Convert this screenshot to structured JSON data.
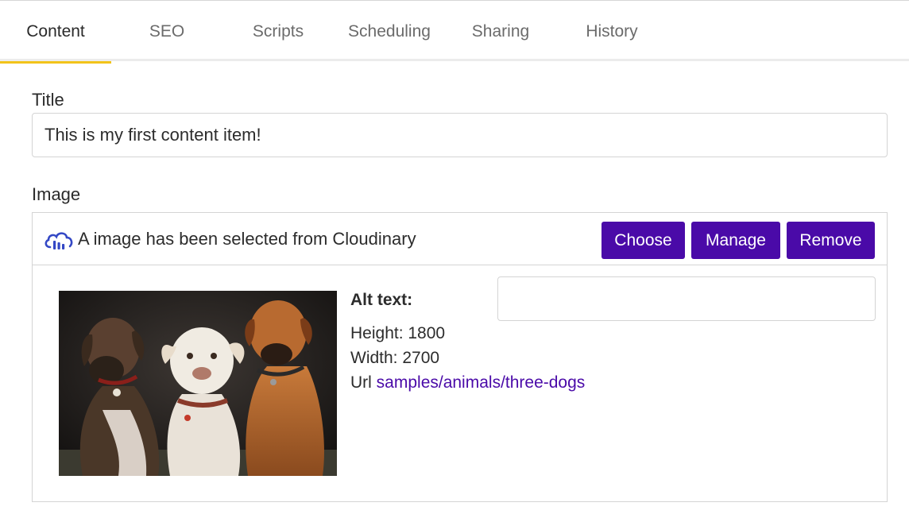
{
  "tabs": [
    {
      "label": "Content",
      "active": true
    },
    {
      "label": "SEO",
      "active": false
    },
    {
      "label": "Scripts",
      "active": false
    },
    {
      "label": "Scheduling",
      "active": false
    },
    {
      "label": "Sharing",
      "active": false
    },
    {
      "label": "History",
      "active": false
    }
  ],
  "title_field": {
    "label": "Title",
    "value": "This is my first content item!"
  },
  "image_field": {
    "label": "Image",
    "status_text": "A image has been selected from Cloudinary",
    "buttons": {
      "choose": "Choose",
      "manage": "Manage",
      "remove": "Remove"
    },
    "alt_text_label": "Alt text:",
    "alt_text_value": "",
    "height_text": "Height: 1800",
    "width_text": "Width: 2700",
    "url_label": "Url",
    "url_value": "samples/animals/three-dogs"
  },
  "colors": {
    "accent_tab": "#f2c31a",
    "button": "#4a0aa8",
    "link": "#4a0aa8",
    "cloud_icon": "#3448c5"
  },
  "icons": [
    "cloudinary-cloud-icon"
  ]
}
